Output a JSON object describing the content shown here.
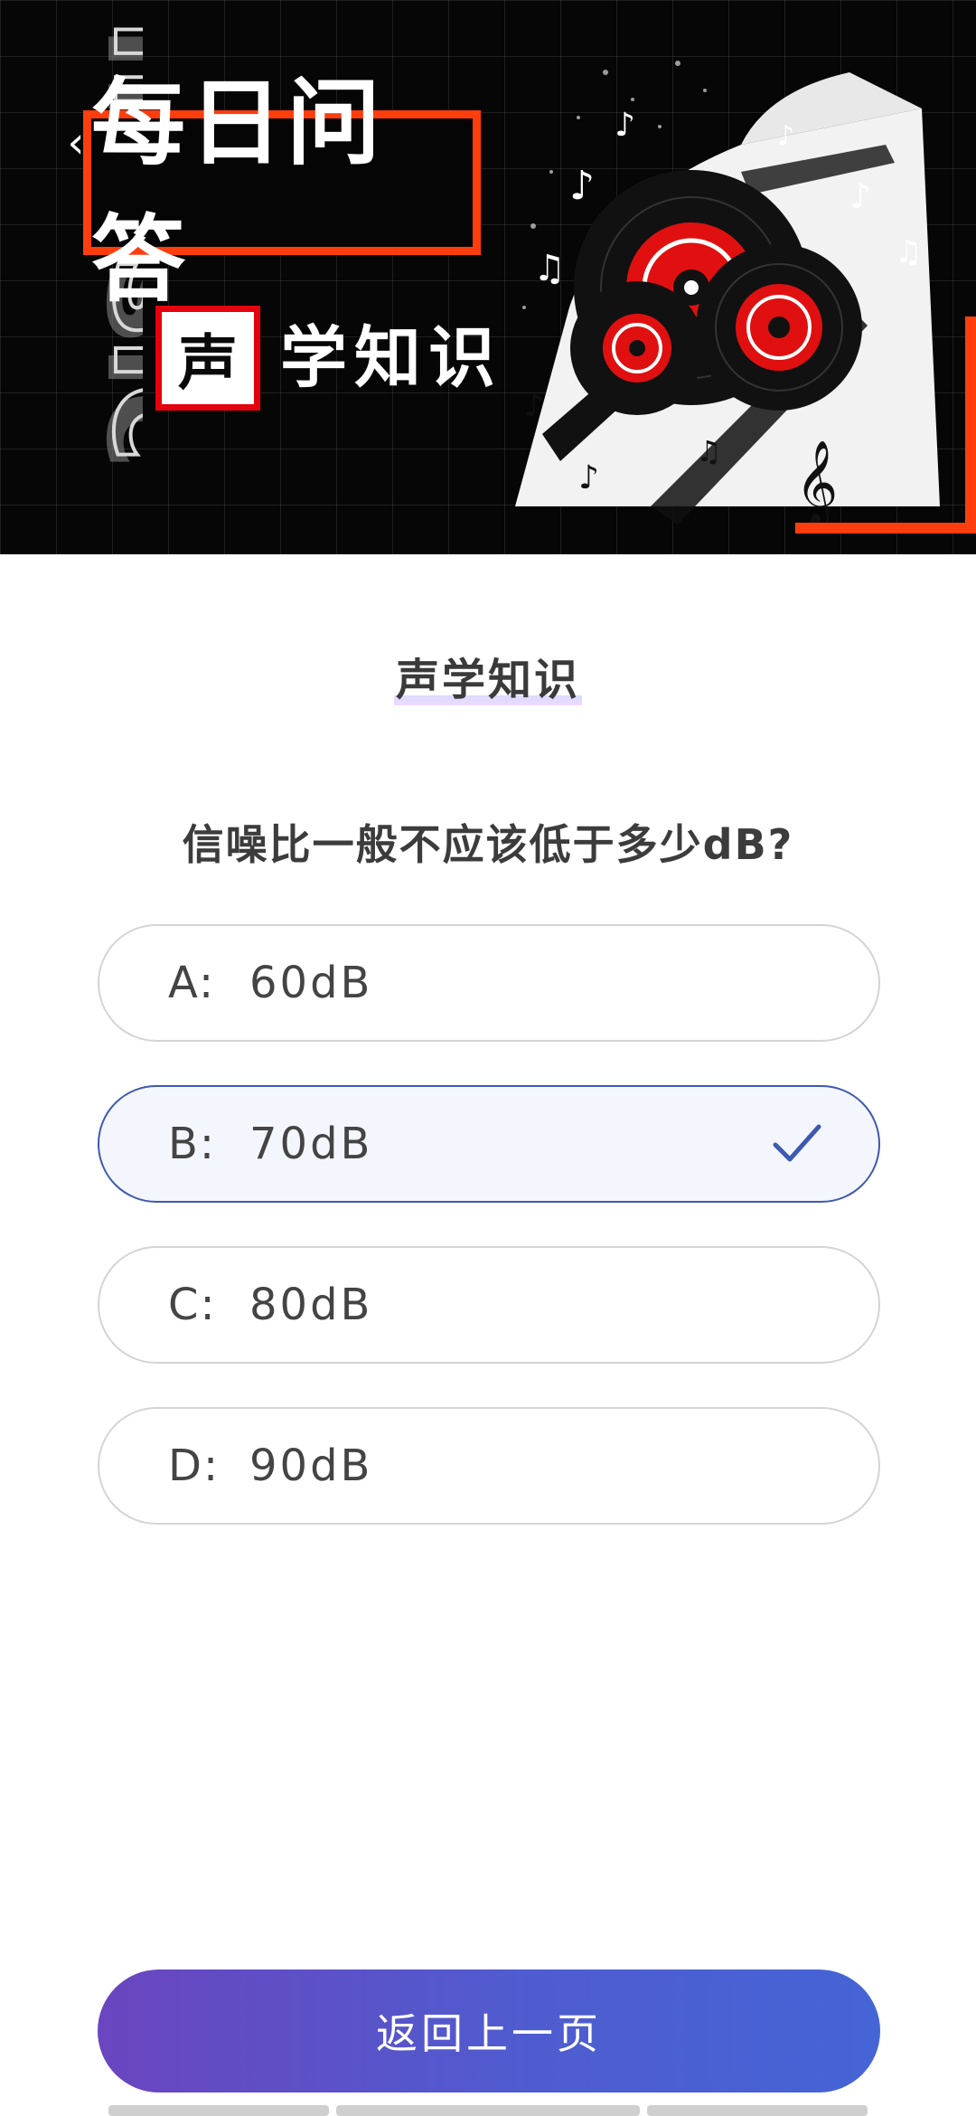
{
  "header": {
    "banner_title": "每日问答",
    "banner_sub_char": "声",
    "banner_sub_rest": "学知识",
    "banner_side_word": "music",
    "back_icon": "chevron-left-icon"
  },
  "main": {
    "section_title": "声学知识",
    "question": "信噪比一般不应该低于多少dB?",
    "options": [
      {
        "letter": "A:",
        "value": "60dB",
        "selected": false
      },
      {
        "letter": "B:",
        "value": "70dB",
        "selected": true
      },
      {
        "letter": "C:",
        "value": "80dB",
        "selected": false
      },
      {
        "letter": "D:",
        "value": "90dB",
        "selected": false
      }
    ],
    "selected_icon": "checkmark-icon"
  },
  "footer": {
    "back_button_label": "返回上一页"
  },
  "colors": {
    "accent_orange": "#ff3d0d",
    "accent_red": "#e4000d",
    "selected_border": "#3f58b0",
    "button_gradient_start": "#6a45c0",
    "button_gradient_end": "#4564d6"
  }
}
